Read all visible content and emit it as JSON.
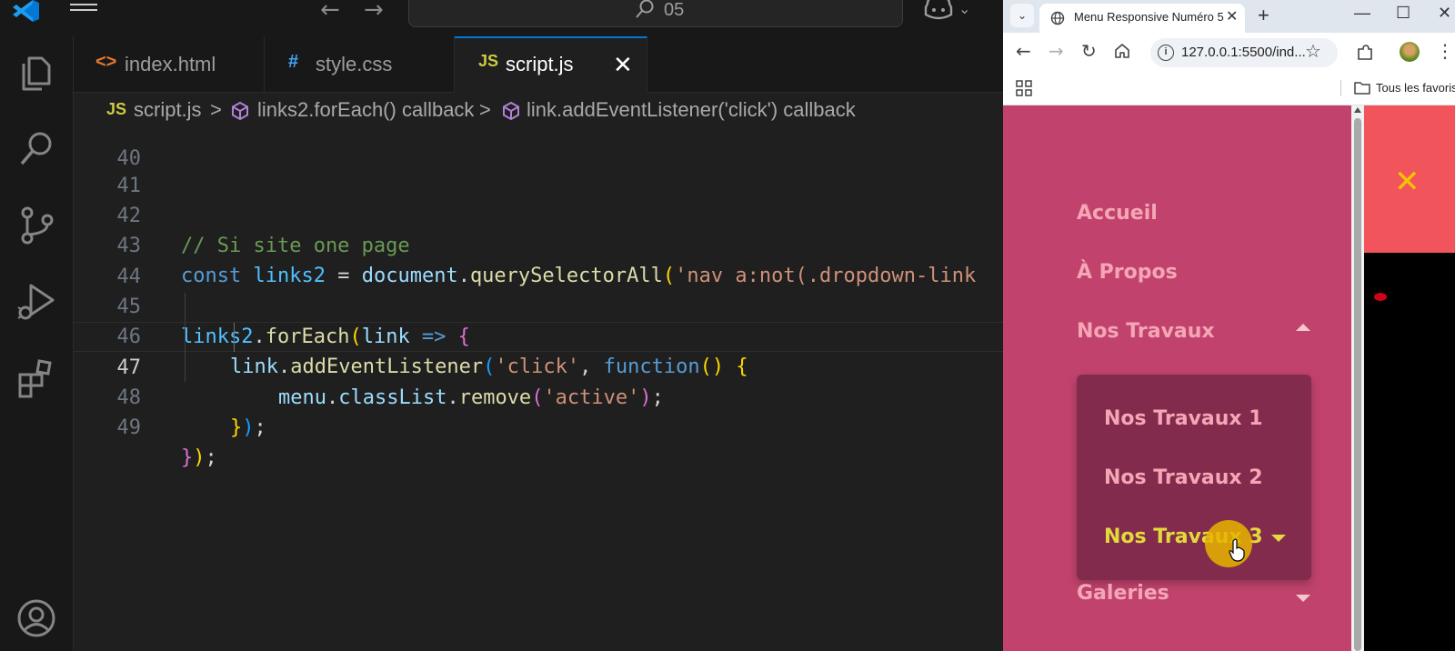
{
  "vscode": {
    "command_center": {
      "text": "05"
    },
    "tabs": [
      {
        "icon": "<>",
        "label": "index.html"
      },
      {
        "icon": "#",
        "label": "style.css"
      },
      {
        "icon": "JS",
        "label": "script.js"
      }
    ],
    "tab_close": "✕",
    "breadcrumb": {
      "file_badge": "JS",
      "file": "script.js",
      "sep": ">",
      "symbol1": "links2.forEach() callback",
      "symbol2": "link.addEventListener('click') callback"
    },
    "lines": {
      "n40": "40",
      "n41": "41",
      "n42": "42",
      "n43": "43",
      "n44": "44",
      "n45": "45",
      "n46": "46",
      "n47": "47",
      "n48": "48",
      "n49": "49"
    },
    "code": {
      "l42_comment": "// Si site one page",
      "l43_const": "const",
      "l43_var": "links2",
      "l43_eq": " = ",
      "l43_doc": "document",
      "l43_dot": ".",
      "l43_fn": "querySelectorAll",
      "l43_paren": "(",
      "l43_str": "'nav a:not(.dropdown-link",
      "l45_var": "links2",
      "l45_dot": ".",
      "l45_fn": "forEach",
      "l45_paren": "(",
      "l45_param": "link",
      "l45_arrow": " => ",
      "l45_brace": "{",
      "l46_obj": "link",
      "l46_dot": ".",
      "l46_fn": "addEventListener",
      "l46_paren": "(",
      "l46_str": "'click'",
      "l46_comma": ", ",
      "l46_kw": "function",
      "l46_parens": "()",
      "l46_sp": " ",
      "l46_brace": "{",
      "l47_obj": "menu",
      "l47_dot1": ".",
      "l47_prop": "classList",
      "l47_dot2": ".",
      "l47_fn": "remove",
      "l47_paren": "(",
      "l47_str": "'active'",
      "l47_close": ")",
      "l47_semi": ";",
      "l48_brace": "}",
      "l48_paren": ")",
      "l48_semi": ";",
      "l49_brace": "}",
      "l49_paren": ")",
      "l49_semi": ";"
    }
  },
  "browser": {
    "tab_title": "Menu Responsive Numéro 5",
    "tab_close": "✕",
    "new_tab": "+",
    "window": {
      "minimize": "—",
      "maximize": "☐",
      "close": "✕"
    },
    "url": "127.0.0.1:5500/ind...",
    "bookmarks_label": "Tous les favoris",
    "page": {
      "close_symbol": "✕",
      "menu_items": [
        "Accueil",
        "À Propos",
        "Nos Travaux",
        "Galeries"
      ],
      "dropdown_items": [
        "Nos Travaux 1",
        "Nos Travaux 2",
        "Nos Travaux 3"
      ],
      "colors": {
        "menu_bg": "#c1436d",
        "dropdown_bg": "#832b4d",
        "header_bg": "#f2545b",
        "link": "#f4a6b6",
        "link_hover": "#e2d93b",
        "close_icon": "#f5c400"
      }
    }
  },
  "icons": {
    "vscode_logo": "vscode-logo",
    "explorer": "files-icon",
    "search": "search-icon",
    "scm": "source-control-icon",
    "debug": "run-debug-icon",
    "extensions": "extensions-icon",
    "account": "account-icon",
    "copilot": "copilot-icon"
  }
}
